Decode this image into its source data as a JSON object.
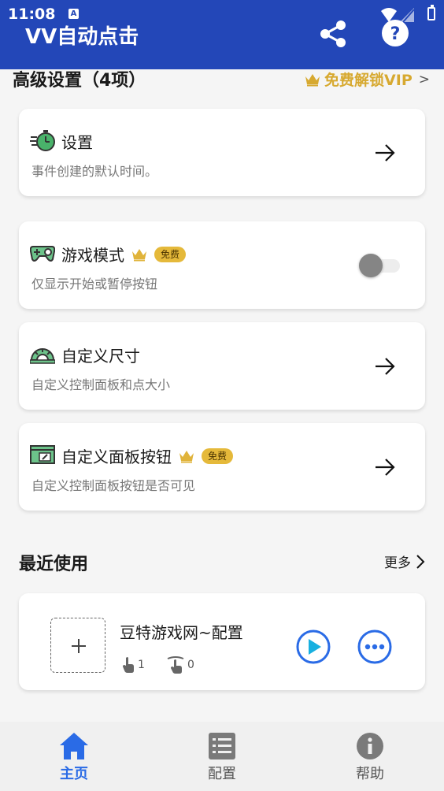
{
  "status_bar": {
    "time": "11:08",
    "notification_letter": "A"
  },
  "app": {
    "title": "VV自动点击",
    "share_icon": "share-icon",
    "help_icon": "help-icon",
    "bar_color": "#2347b8"
  },
  "advanced": {
    "title": "高级设置（4项）",
    "vip_label": "免费解锁VIP",
    "vip_chevron": ">",
    "vip_color": "#d7a930"
  },
  "cards": [
    {
      "icon": "stopwatch-icon",
      "title": "设置",
      "desc": "事件创建的默认时间。",
      "action": "arrow-right-icon"
    },
    {
      "icon": "gamepad-icon",
      "title": "游戏模式",
      "badge": "免费",
      "desc": "仅显示开始或暂停按钮",
      "action": "toggle",
      "toggle_on": false
    },
    {
      "icon": "protractor-icon",
      "title": "自定义尺寸",
      "desc": "自定义控制面板和点大小",
      "action": "arrow-right-icon"
    },
    {
      "icon": "panel-edit-icon",
      "title": "自定义面板按钮",
      "badge": "免费",
      "desc": "自定义控制面板按钮是否可见",
      "action": "arrow-right-icon"
    }
  ],
  "recent": {
    "title": "最近使用",
    "more_label": "更多",
    "item": {
      "name": "豆特游戏网~配置",
      "tap_count": "1",
      "swipe_count": "0"
    }
  },
  "bottom_nav": [
    {
      "label": "主页",
      "icon": "home-icon",
      "active": true
    },
    {
      "label": "配置",
      "icon": "list-icon",
      "active": false
    },
    {
      "label": "帮助",
      "icon": "info-icon",
      "active": false
    }
  ],
  "accent_color": "#2a6be6",
  "badge_color": "#e5b93a"
}
